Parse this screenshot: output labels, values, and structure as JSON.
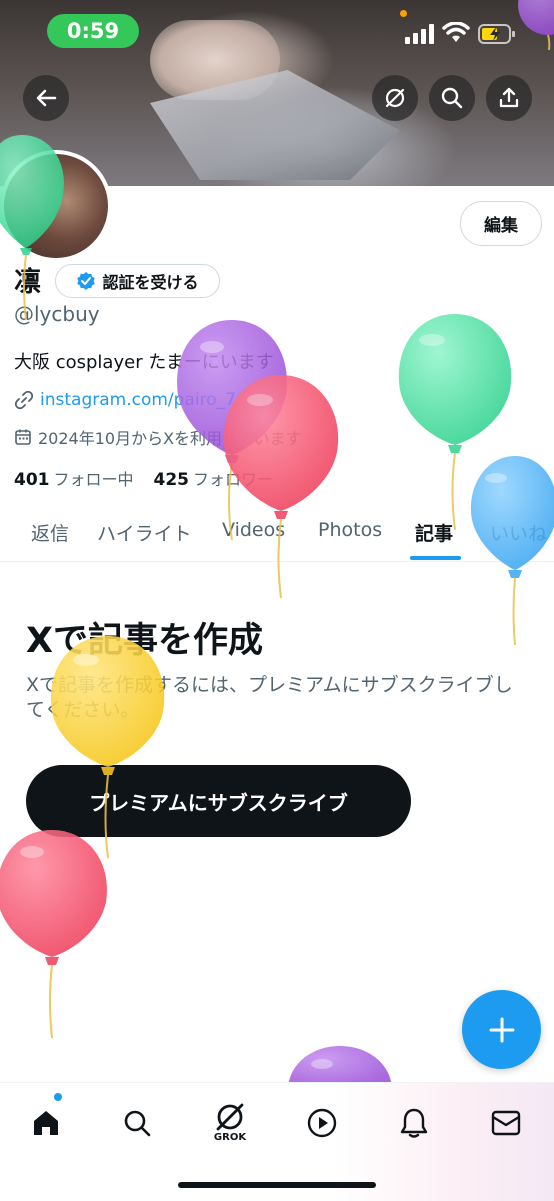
{
  "status_bar": {
    "time": "0:59"
  },
  "profile": {
    "name": "凛",
    "verify_label": "認証を受ける",
    "handle": "@lycbuy",
    "bio": "大阪 cosplayer たまーにいます",
    "link": "instagram.com/pairo_7...",
    "joined": "2024年10月からXを利用しています",
    "following_count": "401",
    "following_label": "フォロー中",
    "followers_count": "425",
    "followers_label": "フォロワー",
    "edit_label": "編集"
  },
  "tabs": [
    {
      "label": "返信"
    },
    {
      "label": "ハイライト"
    },
    {
      "label": "Videos"
    },
    {
      "label": "Photos"
    },
    {
      "label": "記事",
      "active": true
    },
    {
      "label": "いいね"
    }
  ],
  "main": {
    "title": "Xで記事を作成",
    "description": "Xで記事を作成するには、プレミアムにサブスクライブしてください。",
    "subscribe_button": "プレミアムにサブスクライブ"
  },
  "bottom_nav": {
    "items": [
      "home-icon",
      "search-icon",
      "grok-icon",
      "play-icon",
      "bell-icon",
      "mail-icon"
    ],
    "grok_label": "GROK"
  },
  "colors": {
    "accent": "#1d9bf0",
    "text": "#0f1419",
    "secondary": "#536471",
    "status_green": "#34c759"
  }
}
